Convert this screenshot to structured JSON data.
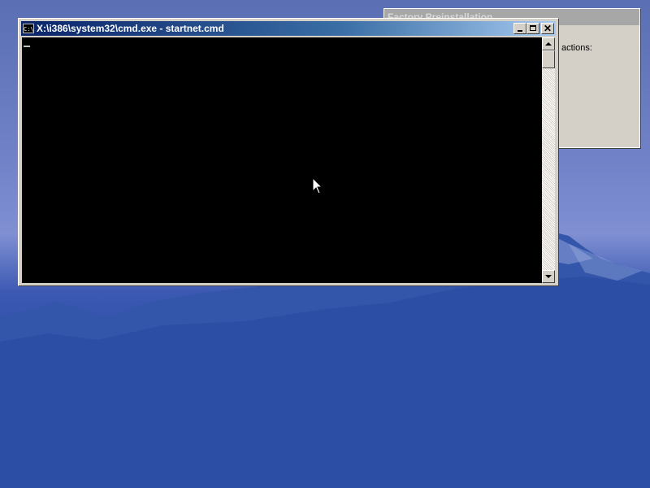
{
  "background_window": {
    "title": "Factory Preinstallation",
    "text": "actions:"
  },
  "console_window": {
    "title": "X:\\i386\\system32\\cmd.exe - startnet.cmd",
    "icon_label": "C:\\",
    "icon": "cmd-icon",
    "controls": {
      "minimize_icon": "minimize-icon",
      "maximize_icon": "maximize-icon",
      "close_icon": "close-icon",
      "close_glyph": "✕"
    },
    "background_color": "#000000",
    "scrollbar": {
      "up_icon": "scroll-up-arrow-icon",
      "down_icon": "scroll-down-arrow-icon",
      "position": 0
    }
  },
  "desktop": {
    "wallpaper": "mountain-wallpaper",
    "pointer_icon": "mouse-pointer-icon"
  }
}
